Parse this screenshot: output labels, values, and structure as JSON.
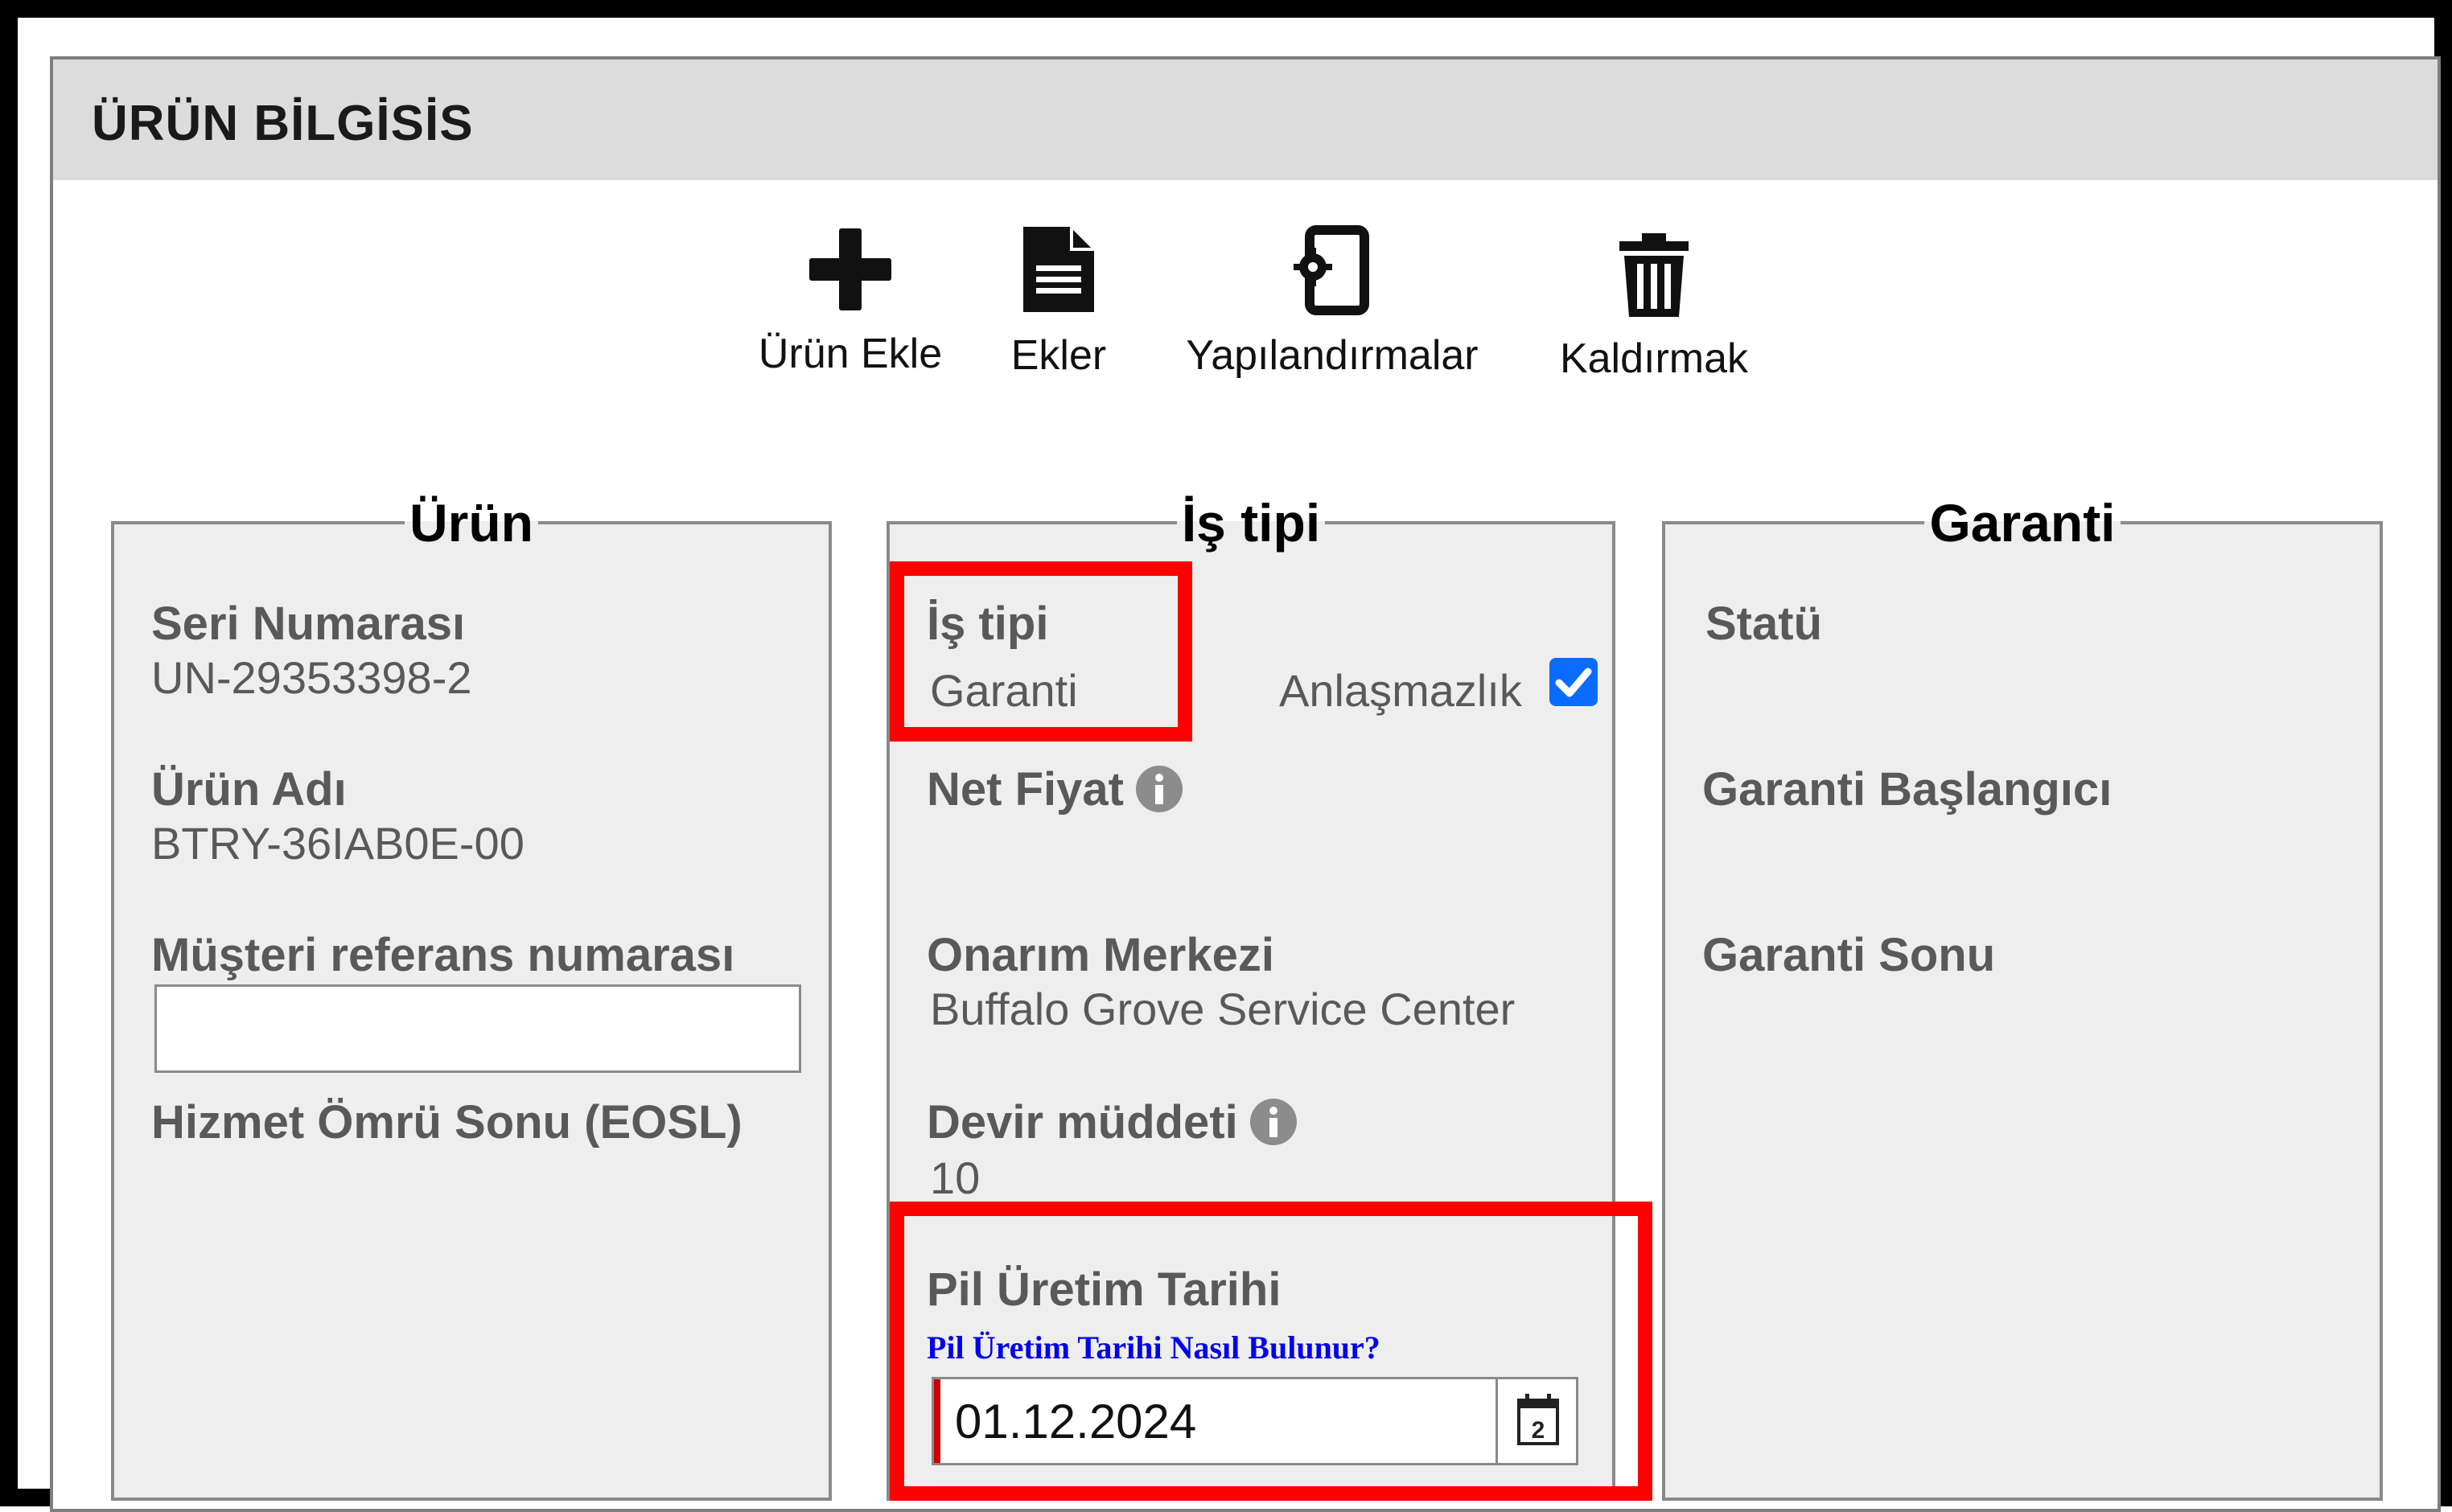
{
  "header": {
    "title": "ÜRÜN BİLGİSİS"
  },
  "toolbar": {
    "add_product": {
      "label": "Ürün Ekle",
      "icon": "plus-icon"
    },
    "attachments": {
      "label": "Ekler",
      "icon": "document-icon"
    },
    "configurations": {
      "label": "Yapılandırmalar",
      "icon": "config-icon"
    },
    "remove": {
      "label": "Kaldırmak",
      "icon": "trash-icon"
    }
  },
  "product": {
    "legend": "Ürün",
    "serial_label": "Seri Numarası",
    "serial_value": "UN-29353398-2",
    "name_label": "Ürün Adı",
    "name_value": "BTRY-36IAB0E-00",
    "customer_ref_label": "Müşteri referans numarası",
    "customer_ref_value": "",
    "eosl_label": "Hizmet Ömrü Sonu (EOSL)"
  },
  "job": {
    "legend": "İş tipi",
    "type_label": "İş tipi",
    "type_value": "Garanti",
    "dispute_label": "Anlaşmazlık",
    "dispute_checked": true,
    "net_price_label": "Net Fiyat",
    "repair_center_label": "Onarım Merkezi",
    "repair_center_value": "Buffalo Grove Service Center",
    "turnover_label": "Devir müddeti",
    "turnover_value": "10",
    "battery_date_label": "Pil Üretim Tarihi",
    "battery_help_link": "Pil Üretim Tarihi Nasıl Bulunur?",
    "battery_date_value": "01.12.2024",
    "calendar_day": "2"
  },
  "warranty": {
    "legend": "Garanti",
    "status_label": "Statü",
    "start_label": "Garanti Başlangıcı",
    "end_label": "Garanti Sonu"
  },
  "colors": {
    "highlight": "#ff0000",
    "checkbox": "#0a6cff",
    "link": "#0000ee",
    "header_bg": "#dcdcdc",
    "group_bg": "#eeeeee"
  }
}
